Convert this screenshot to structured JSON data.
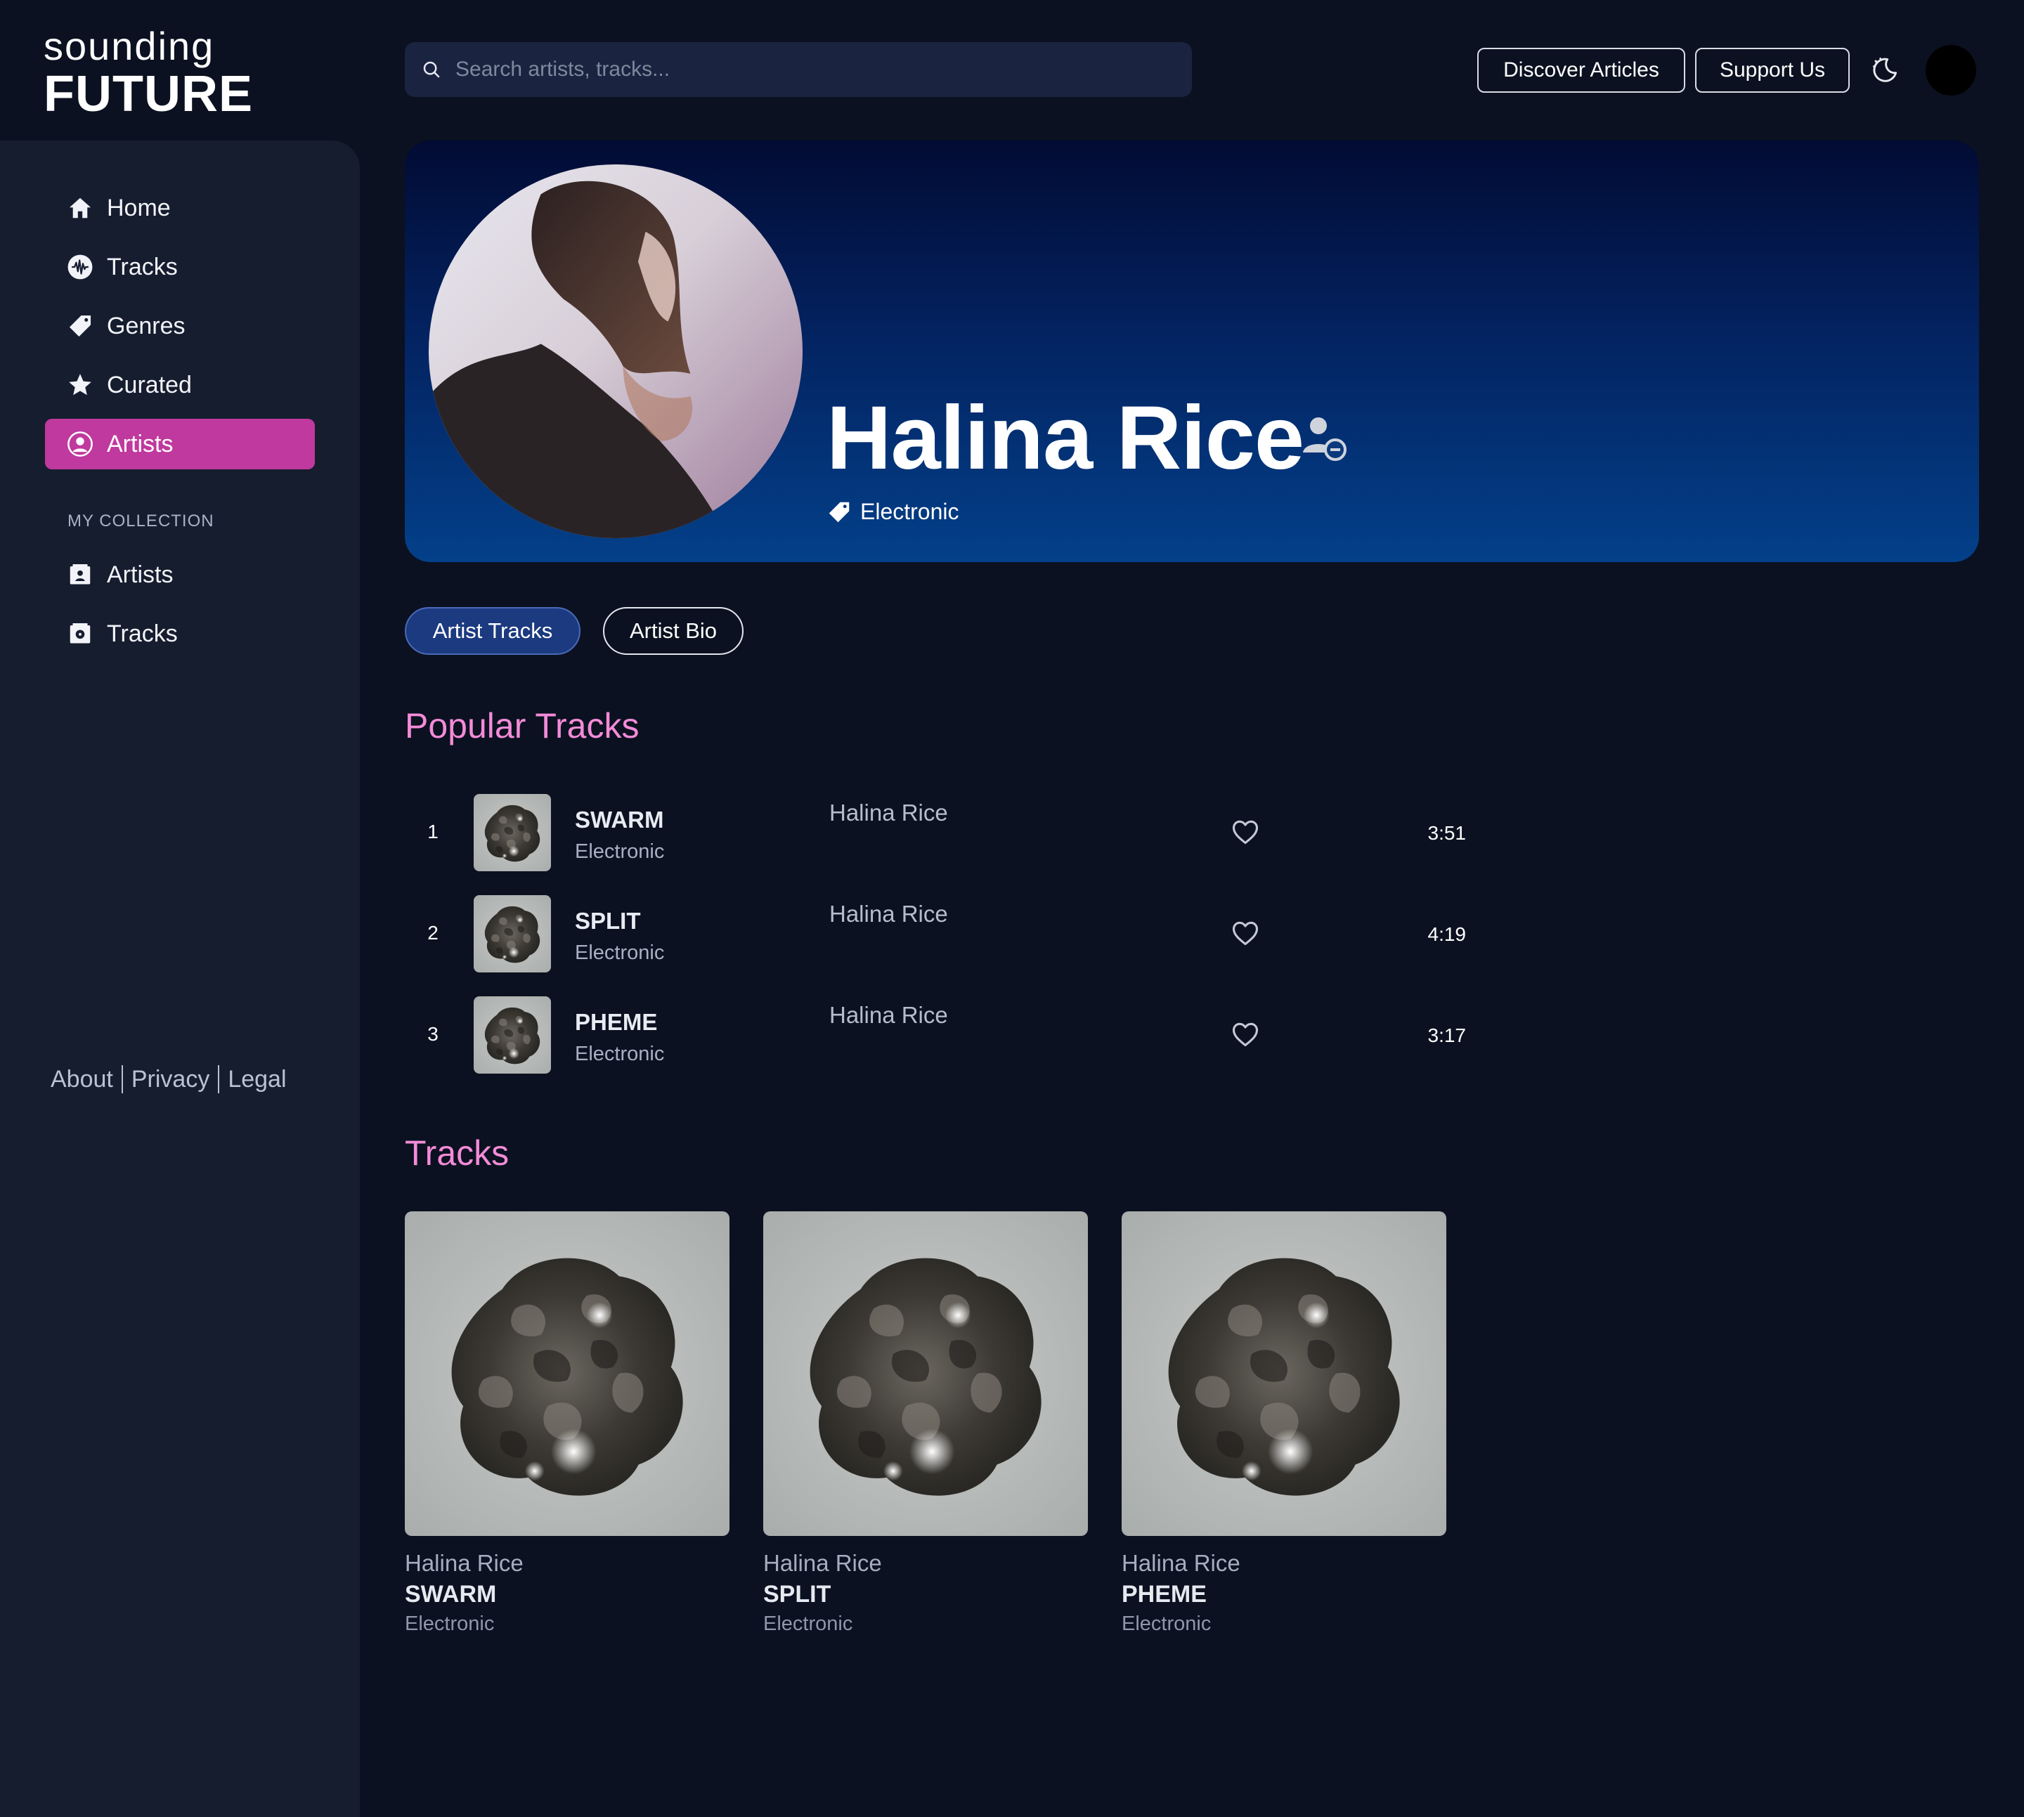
{
  "brand": {
    "line1": "sounding",
    "line2": "FUTURE"
  },
  "search": {
    "placeholder": "Search artists, tracks..."
  },
  "header": {
    "discover_label": "Discover Articles",
    "support_label": "Support Us"
  },
  "sidebar": {
    "nav": [
      {
        "label": "Home",
        "icon": "home-icon"
      },
      {
        "label": "Tracks",
        "icon": "waveform-icon"
      },
      {
        "label": "Genres",
        "icon": "tag-icon"
      },
      {
        "label": "Curated",
        "icon": "star-icon"
      },
      {
        "label": "Artists",
        "icon": "user-circle-icon",
        "active": true
      }
    ],
    "collection_label": "MY COLLECTION",
    "collection": [
      {
        "label": "Artists",
        "icon": "artist-folder-icon"
      },
      {
        "label": "Tracks",
        "icon": "track-folder-icon"
      }
    ],
    "footer": {
      "about": "About",
      "privacy": "Privacy",
      "legal": "Legal"
    }
  },
  "hero": {
    "artist_name": "Halina Rice",
    "genre": "Electronic"
  },
  "tabs": [
    {
      "label": "Artist Tracks",
      "active": true
    },
    {
      "label": "Artist Bio"
    }
  ],
  "popular": {
    "heading": "Popular Tracks",
    "tracks": [
      {
        "rank": "1",
        "title": "SWARM",
        "genre": "Electronic",
        "artist": "Halina Rice",
        "duration": "3:51"
      },
      {
        "rank": "2",
        "title": "SPLIT",
        "genre": "Electronic",
        "artist": "Halina Rice",
        "duration": "4:19"
      },
      {
        "rank": "3",
        "title": "PHEME",
        "genre": "Electronic",
        "artist": "Halina Rice",
        "duration": "3:17"
      }
    ]
  },
  "tracks": {
    "heading": "Tracks",
    "items": [
      {
        "artist": "Halina Rice",
        "title": "SWARM",
        "genre": "Electronic"
      },
      {
        "artist": "Halina Rice",
        "title": "SPLIT",
        "genre": "Electronic"
      },
      {
        "artist": "Halina Rice",
        "title": "PHEME",
        "genre": "Electronic"
      }
    ]
  },
  "colors": {
    "background": "#0b1120",
    "sidebar": "#161d2f",
    "accent_pink": "#c0399e",
    "heading_pink": "#f38bd8",
    "tab_active": "#1b3a80"
  }
}
